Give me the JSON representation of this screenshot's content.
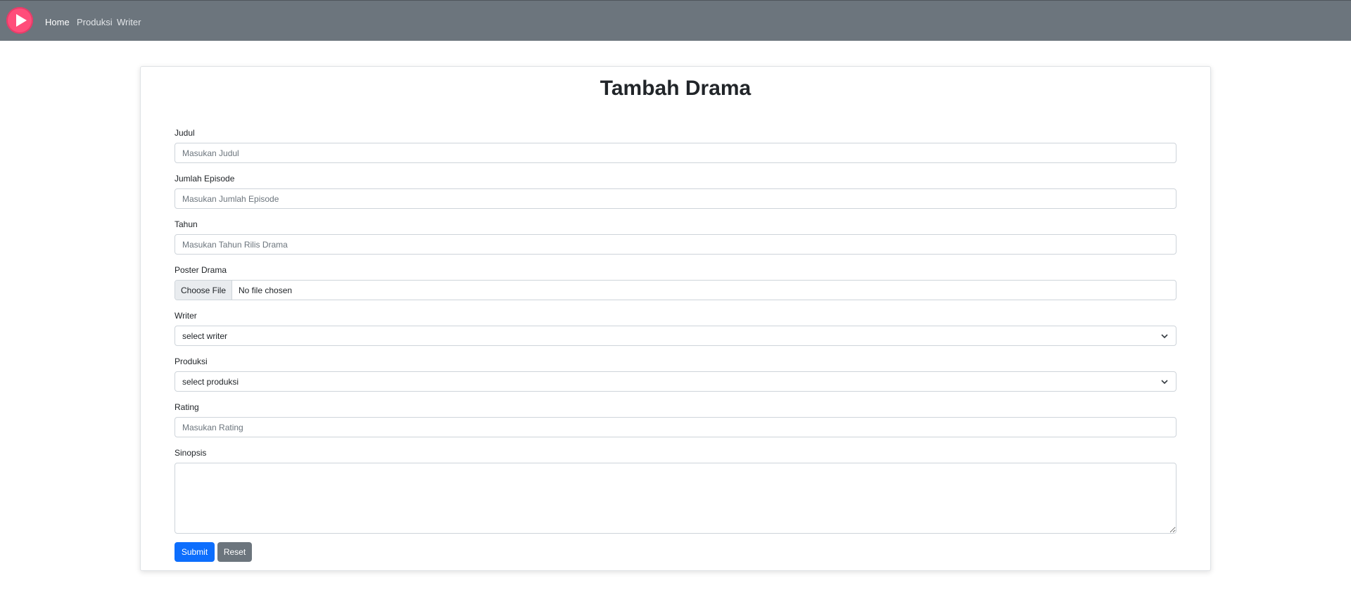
{
  "nav": {
    "items": [
      {
        "label": "Home",
        "active": true
      },
      {
        "label": "Produksi",
        "active": false
      },
      {
        "label": "Writer",
        "active": false
      }
    ],
    "logo_icon": "play-icon",
    "logo_color": "#ff4d7a"
  },
  "form": {
    "title": "Tambah Drama",
    "judul": {
      "label": "Judul",
      "placeholder": "Masukan Judul"
    },
    "episode": {
      "label": "Jumlah Episode",
      "placeholder": "Masukan Jumlah Episode"
    },
    "tahun": {
      "label": "Tahun",
      "placeholder": "Masukan Tahun Rilis Drama"
    },
    "poster": {
      "label": "Poster Drama",
      "button": "Choose File",
      "status": "No file chosen"
    },
    "writer": {
      "label": "Writer",
      "selected": "select writer"
    },
    "produksi": {
      "label": "Produksi",
      "selected": "select produksi"
    },
    "rating": {
      "label": "Rating",
      "placeholder": "Masukan Rating"
    },
    "sinopsis": {
      "label": "Sinopsis"
    },
    "submit_label": "Submit",
    "reset_label": "Reset"
  },
  "colors": {
    "navbar": "#6c757d",
    "primary": "#0d6efd",
    "secondary": "#6c757d"
  }
}
